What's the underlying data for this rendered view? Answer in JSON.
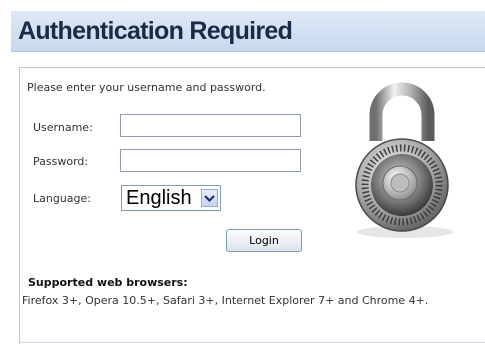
{
  "header": {
    "title": "Authentication Required"
  },
  "form": {
    "intro": "Please enter your username and password.",
    "username_label": "Username:",
    "username_value": "",
    "password_label": "Password:",
    "password_value": "",
    "language_label": "Language:",
    "language_selected": "English",
    "login_label": "Login"
  },
  "icons": {
    "lock": "padlock-icon",
    "dropdown": "chevron-down-icon"
  },
  "browsers": {
    "title": "Supported web browsers:",
    "text": "Firefox 3+, Opera 10.5+, Safari 3+, Internet Explorer 7+ and Chrome 4+."
  },
  "colors": {
    "header_bg": "#d4e1f3",
    "header_text": "#1a2c45",
    "border": "#b9c8dd"
  }
}
